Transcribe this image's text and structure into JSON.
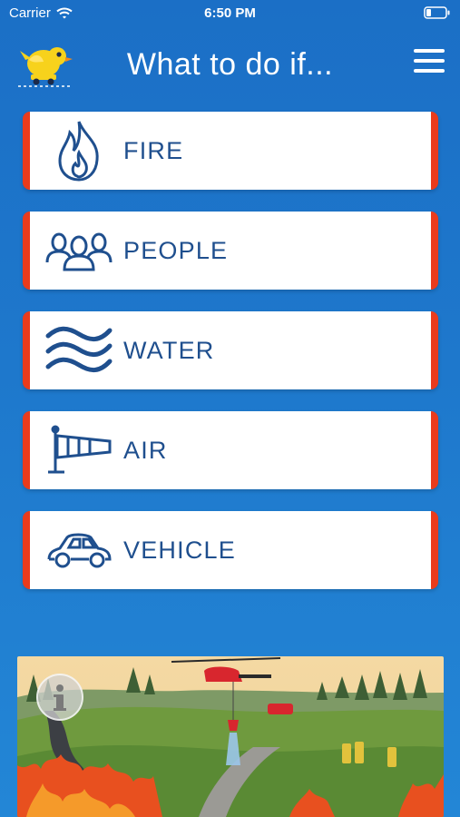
{
  "status_bar": {
    "carrier": "Carrier",
    "time": "6:50 PM"
  },
  "header": {
    "title": "What to do if...",
    "logo_icon": "bird-logo-icon",
    "menu_icon": "hamburger-menu-icon"
  },
  "categories": [
    {
      "label": "FIRE",
      "icon": "fire-icon"
    },
    {
      "label": "PEOPLE",
      "icon": "people-icon"
    },
    {
      "label": "WATER",
      "icon": "water-waves-icon"
    },
    {
      "label": "AIR",
      "icon": "windsock-icon"
    },
    {
      "label": "VEHICLE",
      "icon": "car-icon"
    }
  ],
  "info_button": {
    "icon": "info-icon"
  },
  "colors": {
    "background": "#1e78cc",
    "accent": "#ea3b1c",
    "label": "#1f4f8e"
  }
}
